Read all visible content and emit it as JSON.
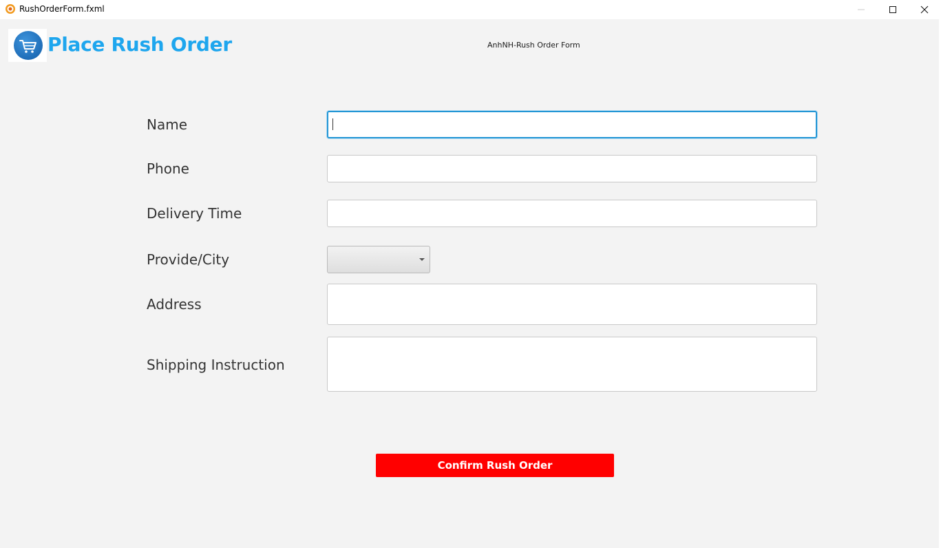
{
  "window": {
    "title": "RushOrderForm.fxml",
    "icon": "app-icon",
    "controls": [
      "minimize-icon",
      "maximize-icon",
      "close-icon"
    ]
  },
  "header": {
    "logo_icon": "shopping-cart-icon",
    "title": "Place Rush Order",
    "caption": "AnhNH-Rush Order Form"
  },
  "form": {
    "name": {
      "label": "Name",
      "value": "",
      "placeholder": ""
    },
    "phone": {
      "label": "Phone",
      "value": "",
      "placeholder": ""
    },
    "delivery_time": {
      "label": "Delivery Time",
      "value": "",
      "placeholder": ""
    },
    "province": {
      "label": "Provide/City",
      "selected": ""
    },
    "address": {
      "label": "Address",
      "value": "",
      "placeholder": ""
    },
    "shipping_instruction": {
      "label": "Shipping Instruction",
      "value": "",
      "placeholder": ""
    },
    "confirm_label": "Confirm Rush Order"
  },
  "colors": {
    "title": "#1ea6ee",
    "focus_border": "#2396d5",
    "confirm_button": "#ff0000",
    "background": "#f3f3f3",
    "logo_circle": "#1f6db8"
  }
}
